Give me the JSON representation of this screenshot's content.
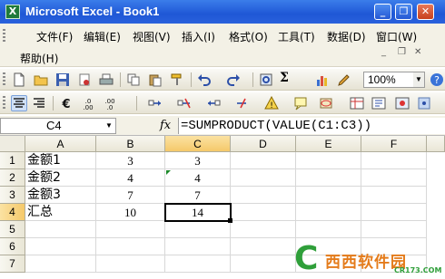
{
  "window": {
    "title": "Microsoft Excel - Book1",
    "icon_label": "X"
  },
  "menu": {
    "items": [
      {
        "label": "文件(F)"
      },
      {
        "label": "编辑(E)"
      },
      {
        "label": "视图(V)"
      },
      {
        "label": "插入(I)"
      },
      {
        "label": "格式(O)"
      },
      {
        "label": "工具(T)"
      },
      {
        "label": "数据(D)"
      },
      {
        "label": "窗口(W)"
      }
    ],
    "help": "帮助(H)"
  },
  "toolbar": {
    "zoom": "100%",
    "sigma": "Σ"
  },
  "formula_bar": {
    "name_box": "C4",
    "fx": "fx",
    "formula": "=SUMPRODUCT(VALUE(C1:C3))"
  },
  "sheet": {
    "columns": [
      "A",
      "B",
      "C",
      "D",
      "E",
      "F"
    ],
    "selected_column": "C",
    "rows": [
      {
        "num": "1",
        "a": "金额1",
        "b": "3",
        "c": "3"
      },
      {
        "num": "2",
        "a": "金额2",
        "b": "4",
        "c": "4"
      },
      {
        "num": "3",
        "a": "金额3",
        "b": "7",
        "c": "7"
      },
      {
        "num": "4",
        "a": "汇总",
        "b": "10",
        "c": "14"
      },
      {
        "num": "5",
        "a": "",
        "b": "",
        "c": ""
      },
      {
        "num": "6",
        "a": "",
        "b": "",
        "c": ""
      },
      {
        "num": "7",
        "a": "",
        "b": "",
        "c": ""
      }
    ],
    "active_cell": "C4"
  },
  "watermark": {
    "brand": "西西软件园",
    "site": "CR173.COM"
  },
  "colors": {
    "title_bar": "#2a62dc",
    "selected_header": "#f5c96a",
    "annotation": "#d21e1e",
    "watermark_green": "#2f9f3a",
    "watermark_orange": "#e47b1a"
  }
}
